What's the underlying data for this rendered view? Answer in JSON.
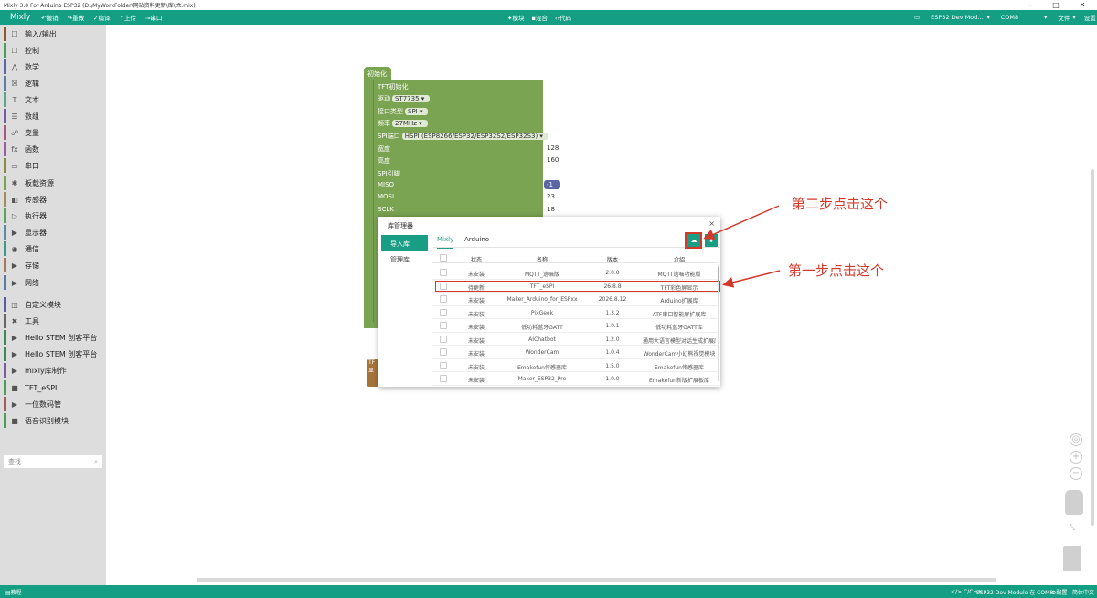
{
  "window": {
    "title": "Mixly 3.0 For Arduino ESP32 (D:\\MyWorkFolder\\网站资料更新\\库\\tft.mix)",
    "minimize_glyph": "–",
    "maximize_glyph": "□",
    "close_glyph": "✕"
  },
  "toolbar": {
    "brand": "Mixly",
    "undo": "撤销",
    "redo": "重做",
    "compile": "编译",
    "upload": "上传",
    "serial": "串口",
    "view_blocks": "模块",
    "view_mixed": "混合",
    "view_code": "代码",
    "board": "ESP32 Dev Mod...",
    "port": "COM8",
    "file": "文件",
    "settings": "设置"
  },
  "sidebar": {
    "items": [
      {
        "label": "输入/输出",
        "icon": "☐",
        "color": "#8a5a2b"
      },
      {
        "label": "控制",
        "icon": "☐",
        "color": "#4a9e5c"
      },
      {
        "label": "数学",
        "icon": "⋀",
        "color": "#5b67a5"
      },
      {
        "label": "逻辑",
        "icon": "☒",
        "color": "#5b80a5"
      },
      {
        "label": "文本",
        "icon": "T",
        "color": "#5ba58c"
      },
      {
        "label": "数组",
        "icon": "☰",
        "color": "#745ba5"
      },
      {
        "label": "变量",
        "icon": "☍",
        "color": "#a55b80"
      },
      {
        "label": "函数",
        "icon": "fx",
        "color": "#995ba5"
      },
      {
        "label": "串口",
        "icon": "▭",
        "color": "#8a8a3a"
      },
      {
        "label": "板载资源",
        "icon": "✱",
        "color": "#7aa352"
      },
      {
        "label": "传感器",
        "icon": "◧",
        "color": "#a58a5b"
      },
      {
        "label": "执行器",
        "icon": "▷",
        "color": "#5ba55b"
      },
      {
        "label": "显示器",
        "icon": "▶",
        "color": "#5b8aa5"
      },
      {
        "label": "通信",
        "icon": "◉",
        "color": "#3a9a8a"
      },
      {
        "label": "存储",
        "icon": "▶",
        "color": "#a5745b"
      },
      {
        "label": "网络",
        "icon": "▶",
        "color": "#5b7aa5"
      },
      {
        "label": "自定义模块",
        "icon": "◫",
        "color": "#5b5ba5"
      },
      {
        "label": "工具",
        "icon": "✖",
        "color": "#666666"
      },
      {
        "label": "Hello STEM 创客平台",
        "icon": "▶",
        "color": "#3a8a5a"
      },
      {
        "label": "Hello STEM 创客平台",
        "icon": "▶",
        "color": "#3a8a5a"
      },
      {
        "label": "mixly库制作",
        "icon": "▶",
        "color": "#7a5ba5"
      },
      {
        "label": "TFT_eSPI",
        "icon": "■",
        "color": "#4a9e5c"
      },
      {
        "label": "一位数码管",
        "icon": "▶",
        "color": "#a55b5b"
      },
      {
        "label": "语音识别模块",
        "icon": "■",
        "color": "#4a9e5c"
      }
    ],
    "search_placeholder": "查找"
  },
  "block": {
    "hat": "初始化",
    "title": "TFT初始化",
    "driver_label": "驱动",
    "driver_value": "ST7735",
    "iface_label": "接口类型",
    "iface_value": "SPI",
    "freq_label": "频率",
    "freq_value": "27MHz",
    "spiport_label": "SPI端口",
    "spiport_value": "HSPI (ESP8266/ESP32/ESP32S2/ESP32S3)",
    "width_label": "宽度",
    "width_value": "128",
    "height_label": "高度",
    "height_value": "160",
    "pins_label": "SPI引脚",
    "miso_label": "MISO",
    "miso_value": "-1",
    "mosi_label": "MOSI",
    "mosi_value": "23",
    "sclk_label": "SCLK",
    "sclk_value": "18",
    "bottom_text": "TF 显"
  },
  "dialog": {
    "title": "库管理器",
    "close": "×",
    "nav_import": "导入库",
    "nav_manage": "管理库",
    "tab_mixly": "Mixly",
    "tab_arduino": "Arduino",
    "cloud_icon_glyph": "☁",
    "download_icon_glyph": "⬇",
    "columns": [
      "状态",
      "名称",
      "版本",
      "介绍"
    ],
    "rows": [
      {
        "status": "未安装",
        "name": "MQTT_遗嘱版",
        "version": "2.0.0",
        "desc": "MQTT遗嘱功能版"
      },
      {
        "status": "待更新",
        "name": "TFT_eSPI",
        "version": "26.8.8",
        "desc": "TFT彩色屏显示"
      },
      {
        "status": "未安装",
        "name": "Maker_Arduino_for_ESPxx",
        "version": "2026.8.12",
        "desc": "Arduino扩展库"
      },
      {
        "status": "未安装",
        "name": "PixGeek",
        "version": "1.3.2",
        "desc": "ATF串口智能屏扩展库"
      },
      {
        "status": "未安装",
        "name": "低功耗蓝牙GATT",
        "version": "1.0.1",
        "desc": "低功耗蓝牙GATT库"
      },
      {
        "status": "未安装",
        "name": "AIChatbot",
        "version": "1.2.0",
        "desc": "通用大语言模型对话生成扩展库，支持SD..."
      },
      {
        "status": "未安装",
        "name": "WonderCam",
        "version": "1.0.4",
        "desc": "WonderCam小幻熊视觉模块"
      },
      {
        "status": "未安装",
        "name": "Emakefun传感器库",
        "version": "1.5.0",
        "desc": "Emakefun传感器库"
      },
      {
        "status": "未安装",
        "name": "Maker_ESP32_Pro",
        "version": "1.0.0",
        "desc": "Emakefun新版扩展板库"
      }
    ]
  },
  "annotations": {
    "step2": "第二步点击这个",
    "step1": "第一步点击这个",
    "color": "#d3392b"
  },
  "statusbar": {
    "left": "教程",
    "lang": "</> C/C++",
    "board_info": "ESP32 Dev Module 在 COM8",
    "config": "配置",
    "lang_switch": "简体中文"
  }
}
